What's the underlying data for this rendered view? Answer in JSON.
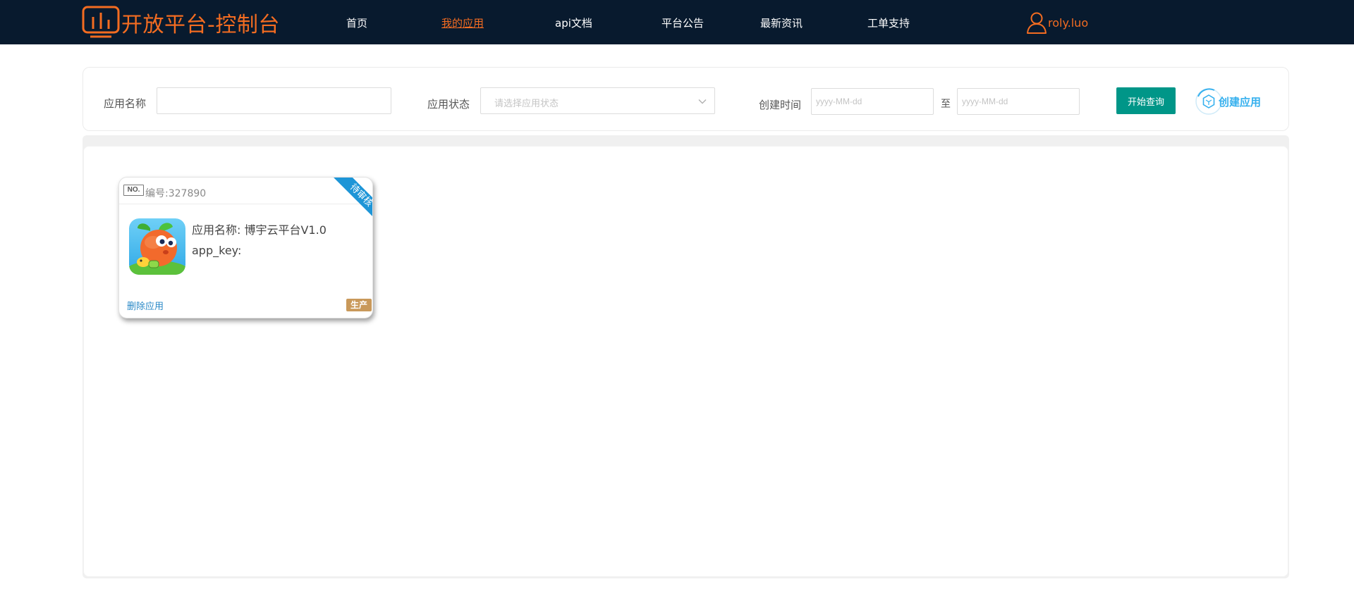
{
  "header": {
    "brand_title": "开放平台-控制台",
    "brand_icon": "monitor-chart-icon",
    "nav": [
      {
        "label": "首页",
        "active": false
      },
      {
        "label": "我的应用",
        "active": true
      },
      {
        "label": "api文档",
        "active": false
      },
      {
        "label": "平台公告",
        "active": false
      },
      {
        "label": "最新资讯",
        "active": false
      },
      {
        "label": "工单支持",
        "active": false
      }
    ],
    "user_icon": "user-icon",
    "username": "roly.luo"
  },
  "search": {
    "app_name_label": "应用名称",
    "app_name_value": "",
    "app_status_label": "应用状态",
    "app_status_placeholder": "请选择应用状态",
    "created_time_label": "创建时间",
    "date_from_placeholder": "yyyy-MM-dd",
    "date_separator": "至",
    "date_to_placeholder": "yyyy-MM-dd",
    "query_button": "开始查询",
    "create_button": "创建应用",
    "create_icon": "hexagon-cube-icon"
  },
  "apps": [
    {
      "no_badge": "NO.",
      "id_text": "编号:327890",
      "status_ribbon": "待审核",
      "icon": "carrot-game-app-icon",
      "name_text": "应用名称: 博宇云平台V1.0",
      "key_text": "app_key:",
      "delete_label": "删除应用",
      "env_badge": "生产"
    }
  ],
  "colors": {
    "header_bg": "#081a2e",
    "accent_orange": "#f36c21",
    "query_button": "#009688",
    "create_link": "#35b0ee",
    "ribbon_blue": "#1d95d7",
    "env_badge": "#c9995a"
  }
}
